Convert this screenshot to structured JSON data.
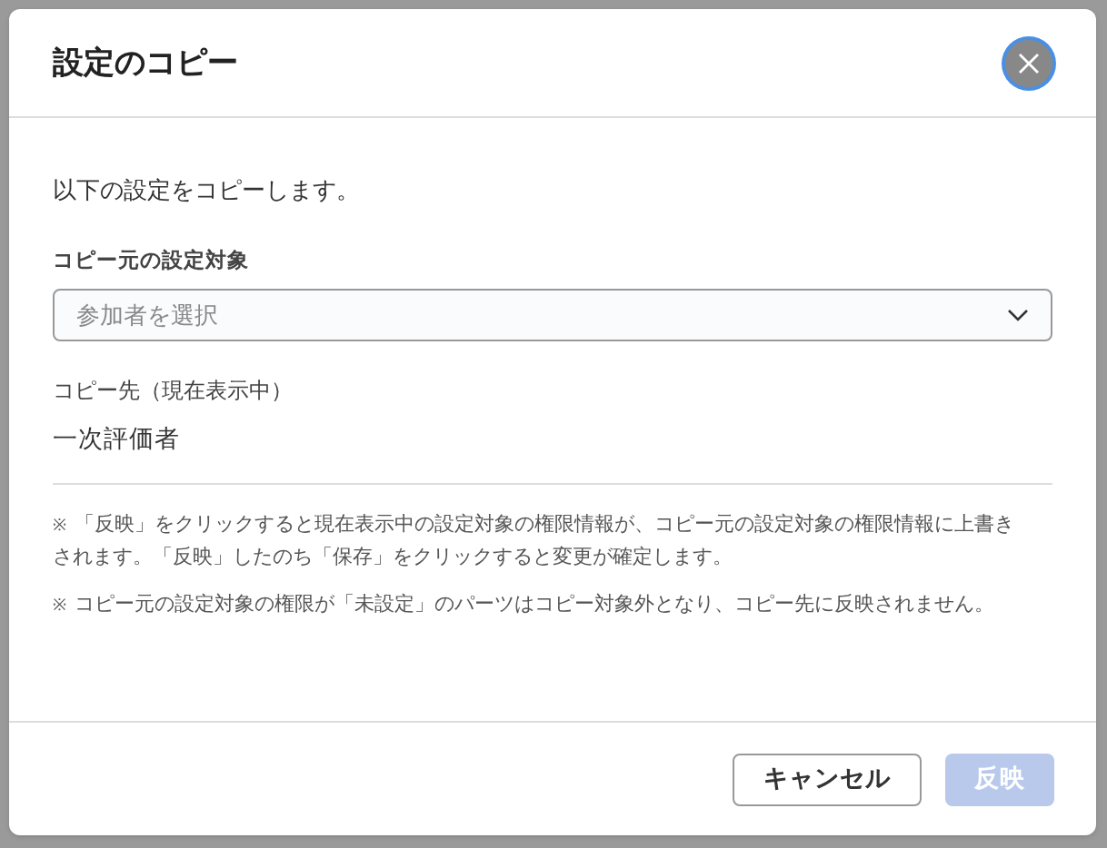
{
  "dialog": {
    "title": "設定のコピー",
    "intro": "以下の設定をコピーします。",
    "source": {
      "label": "コピー元の設定対象",
      "placeholder": "参加者を選択"
    },
    "destination": {
      "label": "コピー先（現在表示中）",
      "value": "一次評価者"
    },
    "notes": [
      {
        "mark": "※",
        "text": "「反映」をクリックすると現在表示中の設定対象の権限情報が、コピー元の設定対象の権限情報に上書きされます。「反映」したのち「保存」をクリックすると変更が確定します。"
      },
      {
        "mark": "※",
        "text": "コピー元の設定対象の権限が「未設定」のパーツはコピー対象外となり、コピー先に反映されません。"
      }
    ],
    "buttons": [
      {
        "kind": "secondary",
        "label": "キャンセル",
        "disabled": false
      },
      {
        "kind": "primary",
        "label": "反映",
        "disabled": true
      }
    ]
  }
}
